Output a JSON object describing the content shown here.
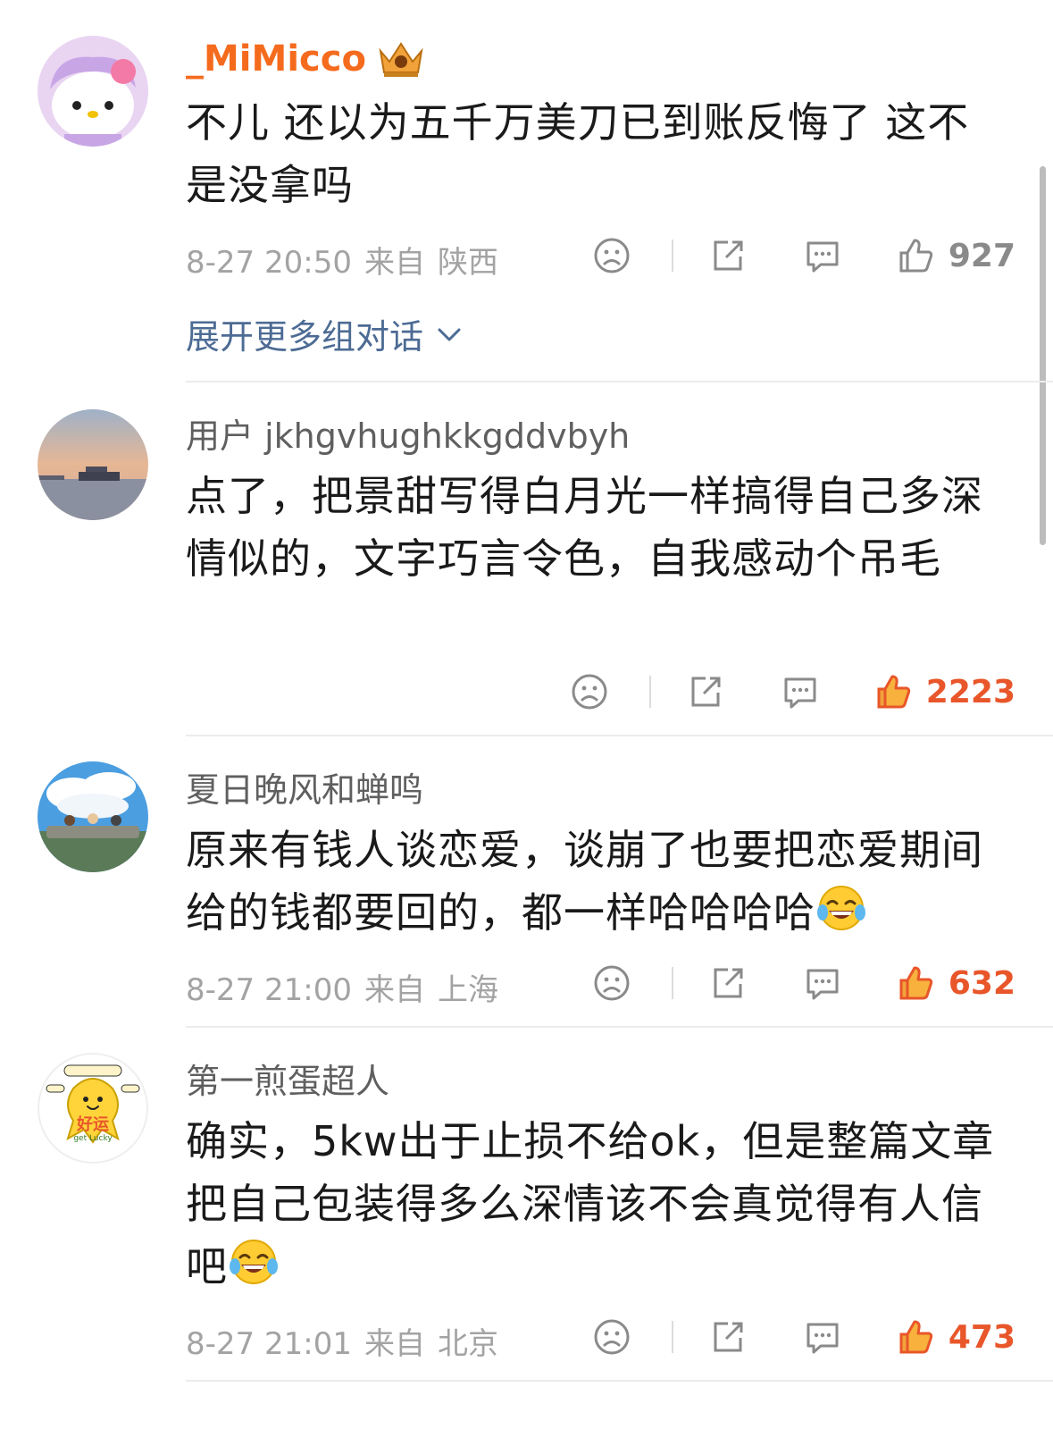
{
  "comments": [
    {
      "username": "_MiMicco",
      "text": "不儿 还以为五千万美刀已到账反悔了 这不是没拿吗",
      "date": "8-27 20:50",
      "from": "来自",
      "location": "陕西",
      "likes": "927",
      "expand_label": "展开更多组对话"
    },
    {
      "username": "用户 jkhgvhughkkgddvbyh",
      "text": "点了，把景甜写得白月光一样搞得自己多深情似的，文字巧言令色，自我感动个吊毛",
      "likes": "2223"
    },
    {
      "username": "夏日晚风和蝉鸣",
      "text": "原来有钱人谈恋爱，谈崩了也要把恋爱期间给的钱都要回的，都一样哈哈哈哈",
      "date": "8-27 21:00",
      "from": "来自",
      "location": "上海",
      "likes": "632"
    },
    {
      "username": "第一煎蛋超人",
      "text": "确实，5kw出于止损不给ok，但是整篇文章把自己包装得多么深情该不会真觉得有人信吧",
      "date": "8-27 21:01",
      "from": "来自",
      "location": "北京",
      "likes": "473",
      "avatar_text_main": "好运",
      "avatar_text_sub": "get Lucky"
    }
  ],
  "colors": {
    "vip_name": "#f56b1e",
    "like_hot": "#e8562a",
    "expand_link": "#4d6b94",
    "meta": "#a3a3a3"
  },
  "icons": {
    "dislike": "sad-face-icon",
    "share": "share-icon",
    "comment": "comment-icon",
    "like": "thumbs-up-icon",
    "crown": "crown-badge-icon",
    "emoji": "laughing-tears-emoji"
  }
}
